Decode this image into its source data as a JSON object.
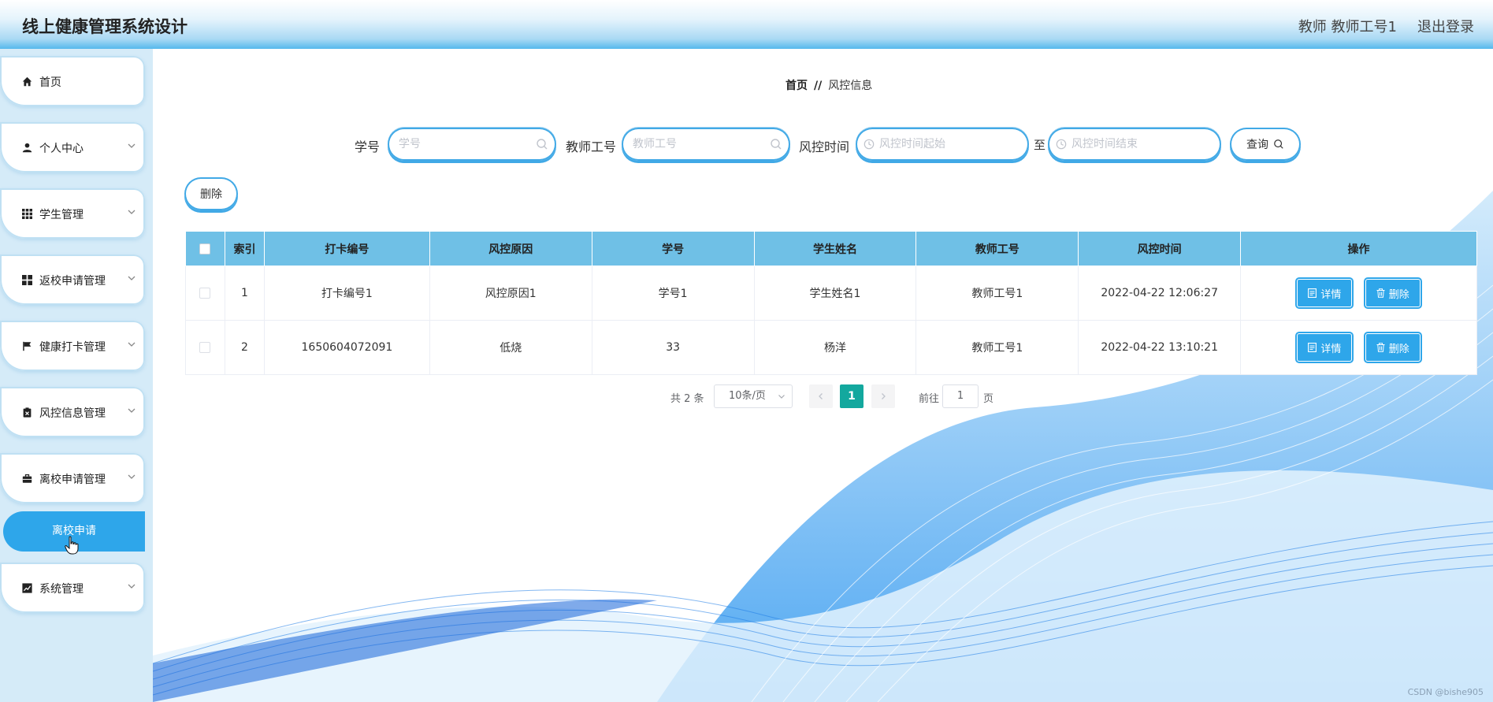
{
  "header": {
    "title": "线上健康管理系统设计",
    "user": "教师 教师工号1",
    "logout": "退出登录"
  },
  "sidebar": {
    "items": [
      {
        "label": "首页",
        "icon": "home-icon"
      },
      {
        "label": "个人中心",
        "icon": "user-icon"
      },
      {
        "label": "学生管理",
        "icon": "grid-icon"
      },
      {
        "label": "返校申请管理",
        "icon": "apps-icon"
      },
      {
        "label": "健康打卡管理",
        "icon": "flag-icon"
      },
      {
        "label": "风控信息管理",
        "icon": "clipboard-icon"
      },
      {
        "label": "离校申请管理",
        "icon": "briefcase-icon"
      },
      {
        "label": "系统管理",
        "icon": "chart-icon"
      }
    ],
    "active_sub": "离校申请"
  },
  "breadcrumb": {
    "home": "首页",
    "separator": "//",
    "current": "风控信息"
  },
  "search": {
    "student_no_label": "学号",
    "student_no_placeholder": "学号",
    "teacher_no_label": "教师工号",
    "teacher_no_placeholder": "教师工号",
    "time_label": "风控时间",
    "time_start_placeholder": "风控时间起始",
    "time_to": "至",
    "time_end_placeholder": "风控时间结束",
    "query_label": "查询"
  },
  "toolbar": {
    "delete_label": "删除"
  },
  "table": {
    "columns": [
      "索引",
      "打卡编号",
      "风控原因",
      "学号",
      "学生姓名",
      "教师工号",
      "风控时间",
      "操作"
    ],
    "rows": [
      {
        "index": "1",
        "checkin_no": "打卡编号1",
        "reason": "风控原因1",
        "student_no": "学号1",
        "student_name": "学生姓名1",
        "teacher_no": "教师工号1",
        "time": "2022-04-22 12:06:27"
      },
      {
        "index": "2",
        "checkin_no": "1650604072091",
        "reason": "低烧",
        "student_no": "33",
        "student_name": "杨洋",
        "teacher_no": "教师工号1",
        "time": "2022-04-22 13:10:21"
      }
    ],
    "detail_label": "详情",
    "delete_label": "删除"
  },
  "pagination": {
    "total": "共 2 条",
    "page_size": "10条/页",
    "current_page": "1",
    "goto_label": "前往",
    "goto_value": "1",
    "page_suffix": "页"
  },
  "watermark": "CSDN @bishe905",
  "colors": {
    "accent": "#2ea6ea",
    "table_header": "#6fc0e6",
    "sidebar_bg": "#d5ebf8",
    "pager_active": "#13a89e"
  }
}
